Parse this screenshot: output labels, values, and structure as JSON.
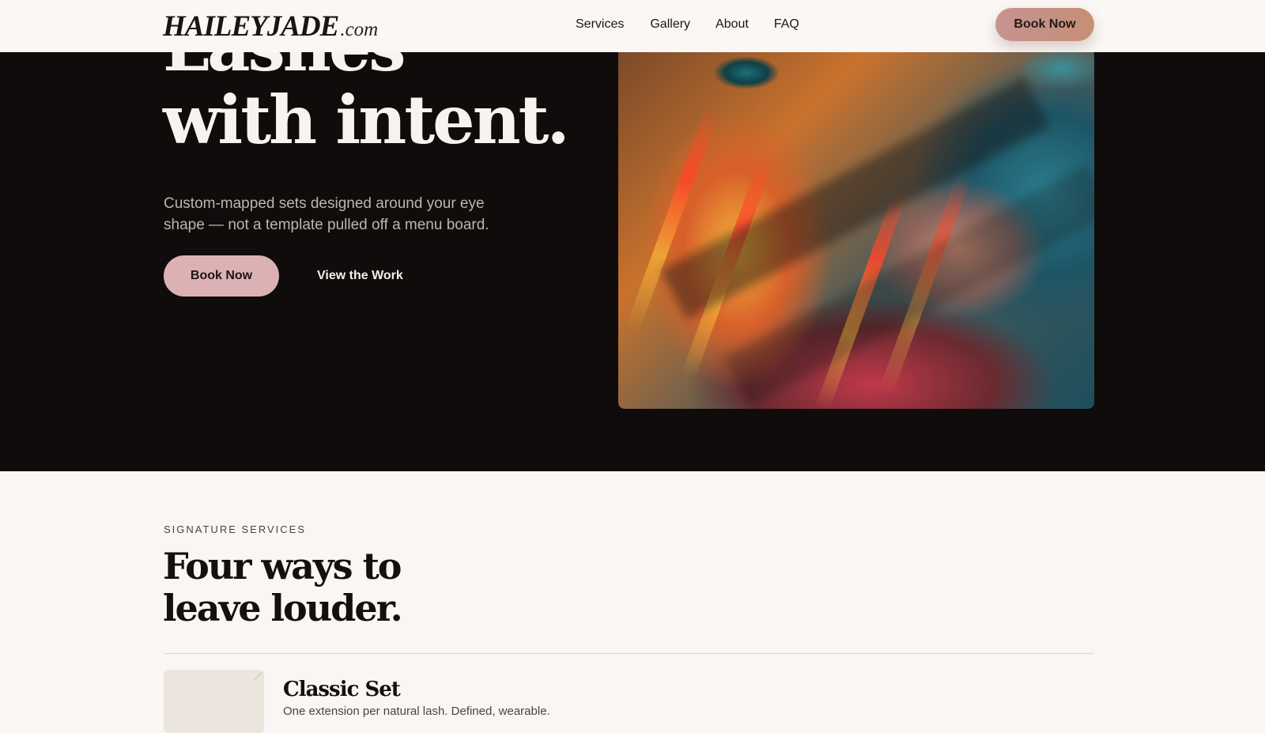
{
  "header": {
    "logo_main": "HAILEYJADE",
    "logo_tld": ".com",
    "nav": [
      "Services",
      "Gallery",
      "About",
      "FAQ"
    ],
    "book_label": "Book Now",
    "book_gradient": [
      "#c7938f",
      "#c98e73"
    ]
  },
  "hero": {
    "title_line1": "Lashes",
    "title_line2": "with intent.",
    "subtitle": "Custom-mapped sets designed around your eye shape — not a template pulled off a menu board.",
    "book_label": "Book Now",
    "work_label": "View the Work",
    "background": "#110c0c",
    "button_color": "#dcb1b4"
  },
  "services": {
    "eyebrow": "SIGNATURE SERVICES",
    "title_line1": "Four ways to",
    "title_line2": "leave louder.",
    "items": [
      {
        "name": "Classic Set",
        "desc": "One extension per natural lash. Defined, wearable."
      }
    ]
  }
}
